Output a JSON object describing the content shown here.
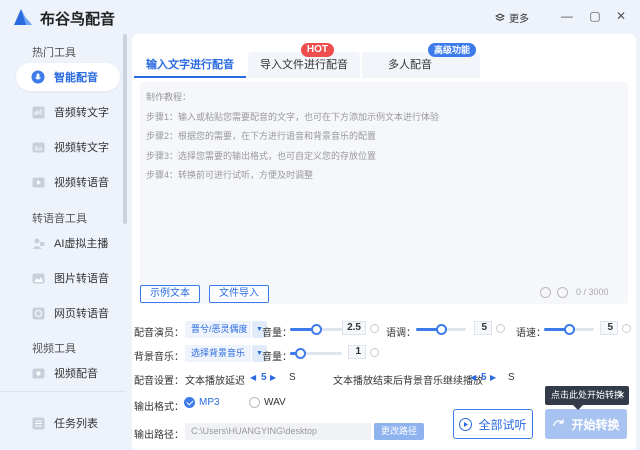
{
  "app": {
    "title": "布谷鸟配音",
    "more_label": "更多"
  },
  "sidebar": {
    "sections": [
      {
        "title": "热门工具",
        "items": [
          {
            "label": "智能配音",
            "icon": "mic-icon",
            "active": true
          },
          {
            "label": "音频转文字",
            "icon": "audio-text-icon"
          },
          {
            "label": "视频转文字",
            "icon": "video-text-icon"
          },
          {
            "label": "视频转语音",
            "icon": "video-audio-icon"
          }
        ]
      },
      {
        "title": "转语音工具",
        "items": [
          {
            "label": "AI虚拟主播",
            "icon": "avatar-icon"
          },
          {
            "label": "图片转语音",
            "icon": "image-icon"
          },
          {
            "label": "网页转语音",
            "icon": "web-icon"
          }
        ]
      },
      {
        "title": "视频工具",
        "items": [
          {
            "label": "视频配音",
            "icon": "video-dub-icon"
          }
        ]
      }
    ],
    "task_list_label": "任务列表"
  },
  "tabs": [
    {
      "label": "输入文字进行配音",
      "active": true
    },
    {
      "label": "导入文件进行配音",
      "badge": "HOT"
    },
    {
      "label": "多人配音",
      "badge": "高级功能"
    }
  ],
  "editor": {
    "tutorial": [
      "制作教程：",
      "步骤1：输入或粘贴您需要配音的文字，也可在下方添加示例文本进行体验",
      "步骤2：根据您的需要，在下方进行语音和背景音乐的配置",
      "步骤3：选择您需要的输出格式，也可自定义您的存放位置",
      "步骤4：转换前可进行试听，方便及时调整"
    ],
    "sample_button": "示例文本",
    "import_button": "文件导入",
    "char_count": "0 / 3000"
  },
  "settings": {
    "voice_label": "配音演员：",
    "voice_value": "晋兮/恶灵偶度",
    "voice_volume_label": "音量：",
    "voice_volume": "2.5",
    "voice_volume_level": 0.5,
    "pitch_label": "语调：",
    "pitch": "5",
    "pitch_level": 0.5,
    "speed_label": "语速：",
    "speed": "5",
    "speed_level": 0.5,
    "bgm_label": "背景音乐：",
    "bgm_value": "选择背景音乐",
    "bgm_volume_label": "音量：",
    "bgm_volume": "1",
    "bgm_volume_level": 0.2,
    "config_label": "配音设置：",
    "delay_label": "文本播放延迟",
    "delay_value": "5",
    "delay_unit": "S",
    "bgm_continue_label": "文本播放结束后背景音乐继续播放",
    "bgm_continue_value": "5",
    "bgm_continue_unit": "S",
    "format_label": "输出格式：",
    "formats": [
      "MP3",
      "WAV"
    ],
    "format_selected": "MP3",
    "path_label": "输出路径：",
    "path_value": "C:\\Users\\HUANGYING\\desktop",
    "change_path_button": "更改路径"
  },
  "actions": {
    "preview_label": "全部试听",
    "start_label": "开始转换",
    "tooltip": "点击此处开始转换"
  },
  "colors": {
    "accent": "#3d7bea",
    "hot": "#ef4e4e",
    "background": "#eef3fb"
  }
}
